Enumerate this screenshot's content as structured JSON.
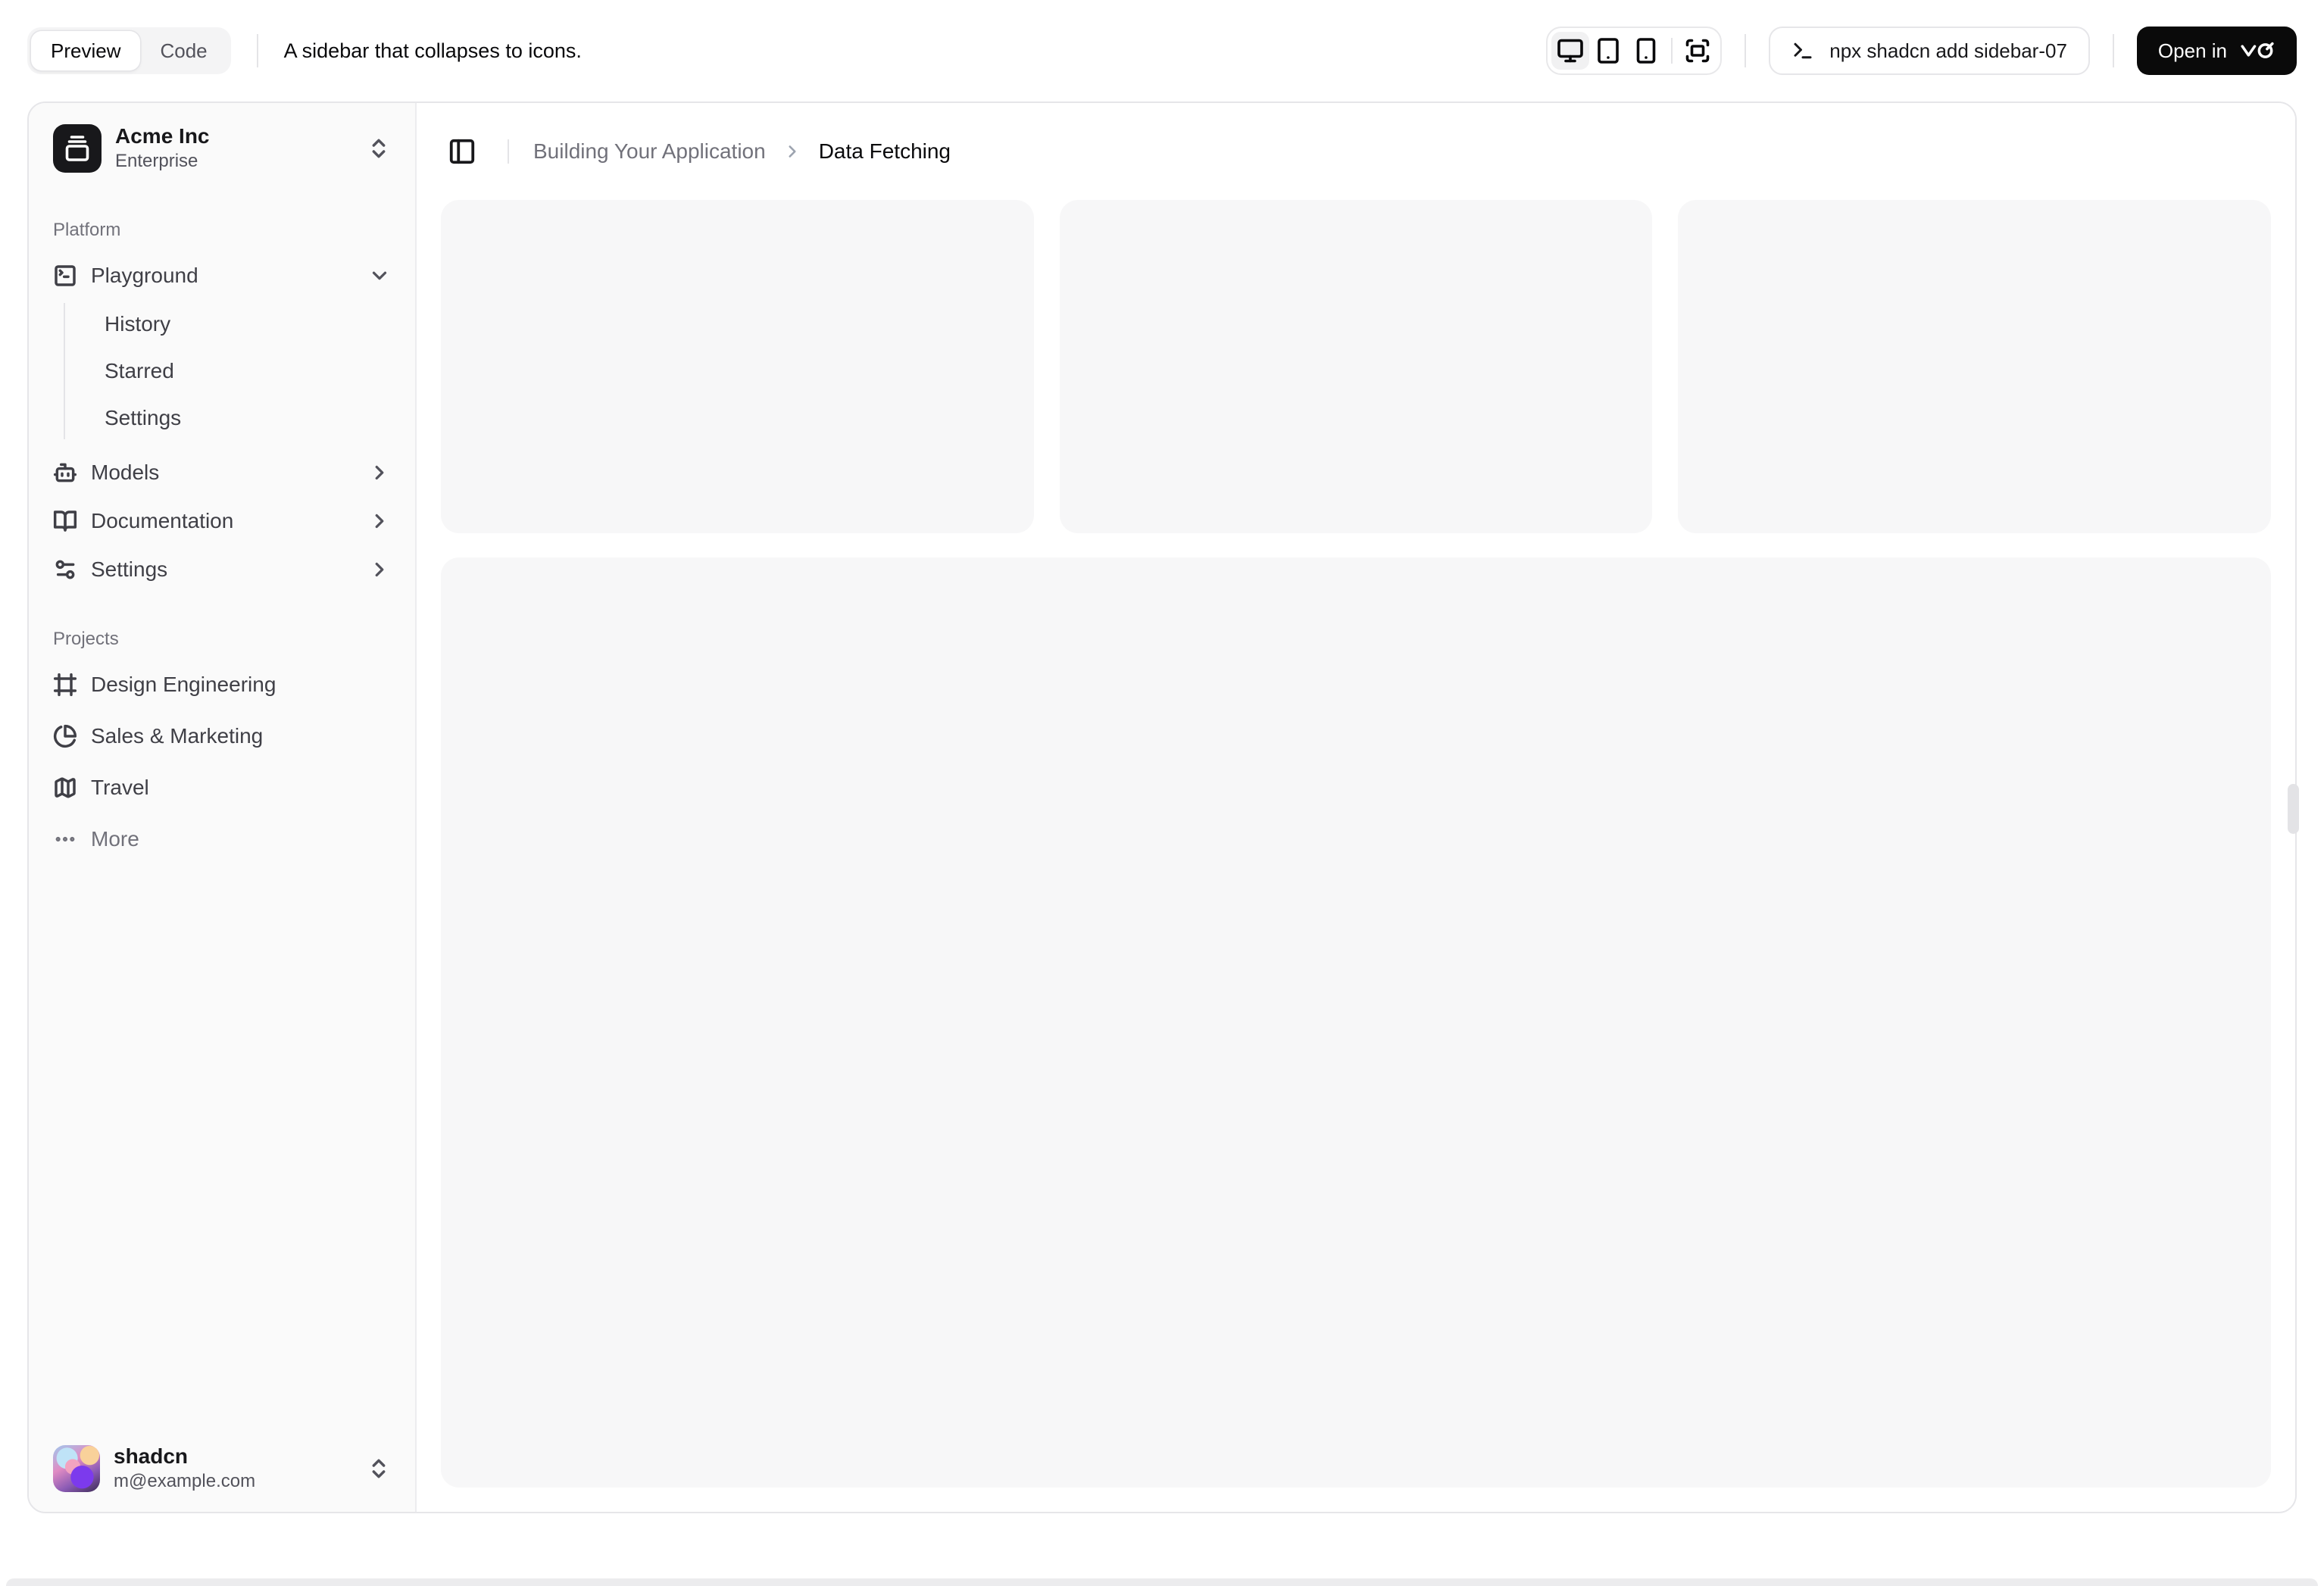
{
  "toolbar": {
    "tabs": [
      {
        "label": "Preview",
        "active": true
      },
      {
        "label": "Code",
        "active": false
      }
    ],
    "description": "A sidebar that collapses to icons.",
    "device_icons": [
      "monitor",
      "tablet",
      "smartphone",
      "fullscreen"
    ],
    "command": "npx shadcn add sidebar-07",
    "open_in_label": "Open in"
  },
  "sidebar": {
    "team": {
      "name": "Acme Inc",
      "plan": "Enterprise"
    },
    "groups": [
      {
        "label": "Platform",
        "items": [
          {
            "label": "Playground",
            "icon": "square-terminal-icon",
            "expanded": true,
            "children": [
              {
                "label": "History"
              },
              {
                "label": "Starred"
              },
              {
                "label": "Settings"
              }
            ]
          },
          {
            "label": "Models",
            "icon": "bot-icon"
          },
          {
            "label": "Documentation",
            "icon": "book-open-icon"
          },
          {
            "label": "Settings",
            "icon": "settings-icon"
          }
        ]
      },
      {
        "label": "Projects",
        "items": [
          {
            "label": "Design Engineering",
            "icon": "frame-icon"
          },
          {
            "label": "Sales & Marketing",
            "icon": "pie-chart-icon"
          },
          {
            "label": "Travel",
            "icon": "map-icon"
          },
          {
            "label": "More",
            "icon": "ellipsis-icon"
          }
        ]
      }
    ],
    "user": {
      "name": "shadcn",
      "email": "m@example.com"
    }
  },
  "main": {
    "breadcrumb": {
      "parent": "Building Your Application",
      "current": "Data Fetching"
    }
  },
  "colors": {
    "accent": "#0a0a0a",
    "border": "#e4e4e7",
    "sidebar_bg": "#fafafa",
    "muted_bg": "#f4f4f5",
    "placeholder_bg": "#f7f7f8",
    "text_muted": "#71717a"
  }
}
